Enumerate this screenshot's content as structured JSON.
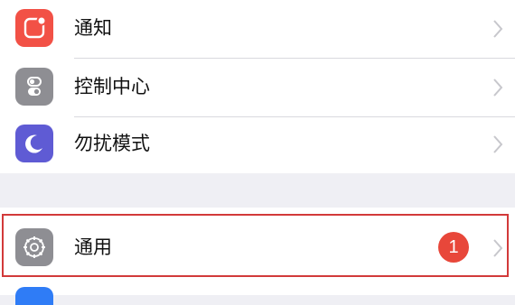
{
  "settings": {
    "group1": [
      {
        "label": "通知",
        "icon": "notifications-icon",
        "color": "#f25146"
      },
      {
        "label": "控制中心",
        "icon": "control-center-icon",
        "color": "#8e8e93"
      },
      {
        "label": "勿扰模式",
        "icon": "moon-icon",
        "color": "#5f5bd4"
      }
    ],
    "group2": [
      {
        "label": "通用",
        "icon": "gear-icon",
        "color": "#8e8e93",
        "badge": "1"
      }
    ],
    "next_item_icon_color": "#2f7cf6"
  },
  "highlight_color": "#d23a3a"
}
